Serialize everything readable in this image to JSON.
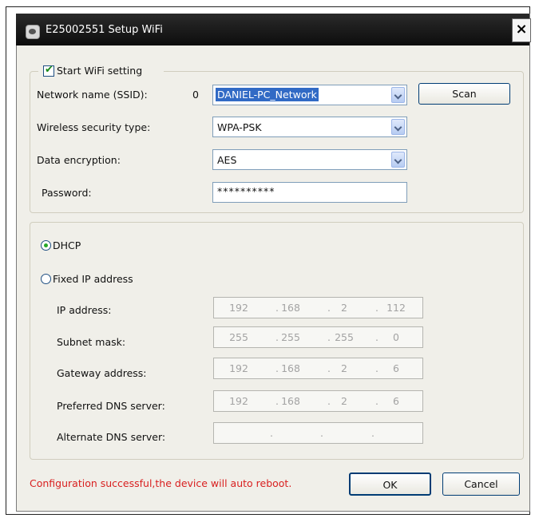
{
  "dialog": {
    "title": "E25002551  Setup WiFi",
    "close_label": "×"
  },
  "wifi": {
    "start_label": "Start WiFi setting",
    "start_checked": true,
    "ssid_label": "Network name (SSID):",
    "ssid_index": "0",
    "ssid_value": "DANIEL-PC_Network",
    "scan_label": "Scan",
    "security_label": "Wireless security type:",
    "security_value": "WPA-PSK",
    "encryption_label": "Data encryption:",
    "encryption_value": "AES",
    "password_label": "Password:",
    "password_value": "**********"
  },
  "ip": {
    "dhcp_label": "DHCP",
    "fixed_label": "Fixed IP address",
    "selected_mode": "DHCP",
    "fields": [
      {
        "label": "IP address:",
        "octets": [
          "192",
          "168",
          "2",
          "112"
        ]
      },
      {
        "label": "Subnet mask:",
        "octets": [
          "255",
          "255",
          "255",
          "0"
        ]
      },
      {
        "label": "Gateway address:",
        "octets": [
          "192",
          "168",
          "2",
          "6"
        ]
      },
      {
        "label": "Preferred DNS server:",
        "octets": [
          "192",
          "168",
          "2",
          "6"
        ]
      },
      {
        "label": "Alternate DNS server:",
        "octets": [
          "",
          "",
          "",
          ""
        ]
      }
    ]
  },
  "footer": {
    "status_message": "Configuration successful,the device will auto reboot.",
    "ok_label": "OK",
    "cancel_label": "Cancel"
  },
  "colors": {
    "status_text": "#d92020",
    "title_bar": "#111111",
    "selection": "#316ac5"
  }
}
